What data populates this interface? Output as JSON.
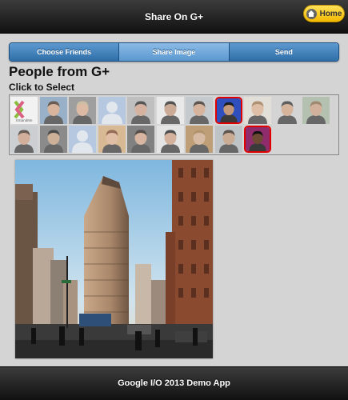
{
  "header": {
    "title": "Share On G+",
    "home_label": "Home",
    "home_icon": "home-icon"
  },
  "tabs": [
    {
      "label": "Choose Friends",
      "active": false
    },
    {
      "label": "Share Image",
      "active": true
    },
    {
      "label": "Send",
      "active": false
    }
  ],
  "people": {
    "title": "People from G+",
    "subtitle": "Click to Select",
    "logo_text": "XStandMe",
    "row1": [
      {
        "kind": "logo",
        "selected": false
      },
      {
        "kind": "photo",
        "bg": "#7fa3c4",
        "skin": "#d9a783",
        "hair": "#3b2a1e",
        "selected": false
      },
      {
        "kind": "photo",
        "bg": "#8a8a8a",
        "skin": "#e0b090",
        "hair": "#c9b58f",
        "selected": false
      },
      {
        "kind": "silhouette",
        "selected": false
      },
      {
        "kind": "photo",
        "bg": "#b7b7b7",
        "skin": "#d4a58a",
        "hair": "#222222",
        "selected": false
      },
      {
        "kind": "photo",
        "bg": "#f2f2f2",
        "skin": "#c89a7c",
        "hair": "#1e1e1e",
        "selected": false
      },
      {
        "kind": "photo",
        "bg": "#c0c7cc",
        "skin": "#d7a685",
        "hair": "#2b2018",
        "selected": false
      },
      {
        "kind": "photo",
        "bg": "#2f4fbf",
        "skin": "#c3977a",
        "hair": "#1c1c1c",
        "selected": true
      },
      {
        "kind": "photo",
        "bg": "#e9e4dc",
        "skin": "#e3b695",
        "hair": "#a0754c",
        "selected": false
      },
      {
        "kind": "photo",
        "bg": "#d5d5d5",
        "skin": "#d8a785",
        "hair": "#2c2c2c",
        "selected": false
      },
      {
        "kind": "photo",
        "bg": "#a9b9a2",
        "skin": "#d2a384",
        "hair": "#8a6a48",
        "selected": false
      }
    ],
    "row2": [
      {
        "kind": "photo",
        "bg": "#c8cdd2",
        "skin": "#d2a084",
        "hair": "#3a2a1e",
        "selected": false
      },
      {
        "kind": "photo",
        "bg": "#6d6d6d",
        "skin": "#caa17f",
        "hair": "#111111",
        "selected": false
      },
      {
        "kind": "silhouette",
        "selected": false
      },
      {
        "kind": "photo",
        "bg": "#d9b07a",
        "skin": "#e4b592",
        "hair": "#7a3f22",
        "selected": false
      },
      {
        "kind": "photo",
        "bg": "#5f5f5f",
        "skin": "#d9a98b",
        "hair": "#201510",
        "selected": false
      },
      {
        "kind": "photo",
        "bg": "#ececec",
        "skin": "#d4a386",
        "hair": "#151515",
        "selected": false
      },
      {
        "kind": "photo",
        "bg": "#b5884f",
        "skin": "#d9b08f",
        "hair": "#a37a44",
        "selected": false
      },
      {
        "kind": "photo",
        "bg": "#b6bcc1",
        "skin": "#c79a79",
        "hair": "#2b1f15",
        "selected": false
      },
      {
        "kind": "photo",
        "bg": "#8f2c6b",
        "skin": "#6e4a34",
        "hair": "#111111",
        "selected": true
      }
    ]
  },
  "footer": {
    "text": "Google I/O 2013 Demo App"
  },
  "colors": {
    "tab_blue": "#2f6ea8",
    "home_yellow": "#f2b800",
    "selection_red": "#e00000"
  }
}
